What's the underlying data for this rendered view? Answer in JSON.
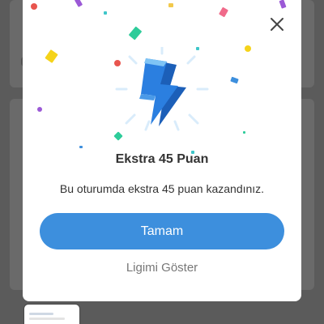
{
  "colors": {
    "overlay": "#5b5b5b",
    "modal_bg": "#ffffff",
    "primary": "#3d8fdd",
    "text": "#333333",
    "muted": "#777777"
  },
  "modal": {
    "title": "Ekstra 45 Puan",
    "message": "Bu oturumda ekstra 45 puan kazandınız.",
    "primary_button": "Tamam",
    "secondary_link": "Ligimi Göster",
    "badge_icon": "lightning-bolt-icon",
    "close_icon": "close-icon"
  }
}
